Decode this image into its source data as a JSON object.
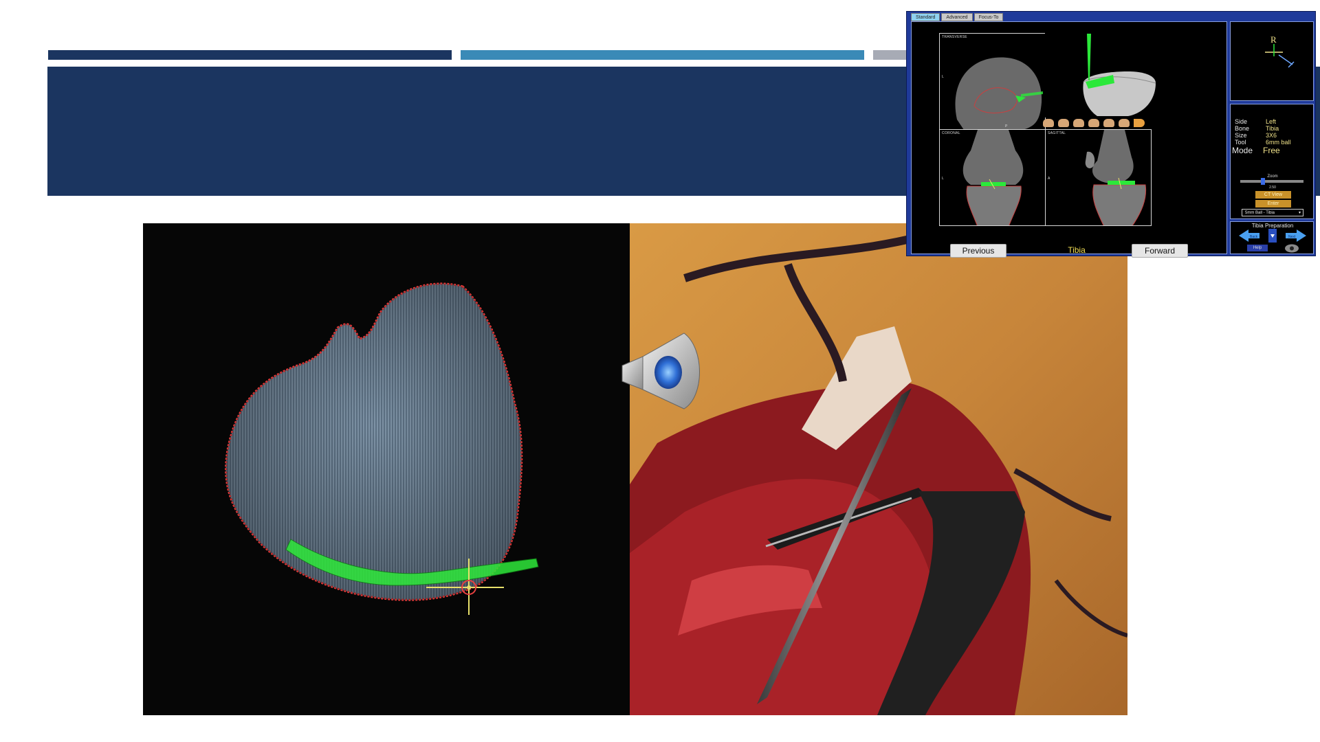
{
  "slide": {
    "accent_colors": [
      "#1b3560",
      "#3a8ab7",
      "#a7abb5"
    ],
    "title_banner_color": "#1b3560",
    "title": ""
  },
  "media": {
    "left_pane": "ct-axial-tibia-with-resection-path",
    "right_pane": "intraoperative-knee-photo",
    "audio_icon": "speaker-icon"
  },
  "nav_software": {
    "tabs": [
      "Standard",
      "Advanced",
      "Focus-To"
    ],
    "active_tab": "Standard",
    "panels": {
      "top_left": "TRANSVERSE",
      "bottom_left": "CORONAL",
      "bottom_right": "SAGITTAL"
    },
    "orientation_marks": {
      "posterior": "P",
      "left": "L",
      "anterior": "A"
    },
    "buttons": {
      "previous": "Previous",
      "forward": "Forward"
    },
    "bone_title": "Tibia",
    "info": {
      "side_label": "Side",
      "side_value": "Left",
      "bone_label": "Bone",
      "bone_value": "Tibia",
      "size_label": "Size",
      "size_value": "3X6",
      "tool_label": "Tool",
      "tool_value": "6mm ball",
      "mode_label": "Mode",
      "mode_value": "Free"
    },
    "zoom": {
      "label": "Zoom",
      "value": "2.50",
      "level": 0.35
    },
    "ct_view_button": "CT View",
    "second_button": "Enter",
    "tool_select": "5mm Ball - Tibia",
    "preparation_title": "Tibia Preparation",
    "back_label": "Back",
    "next_label": "Next",
    "help_label": "Help",
    "accent_color": "#1f3a9a"
  }
}
